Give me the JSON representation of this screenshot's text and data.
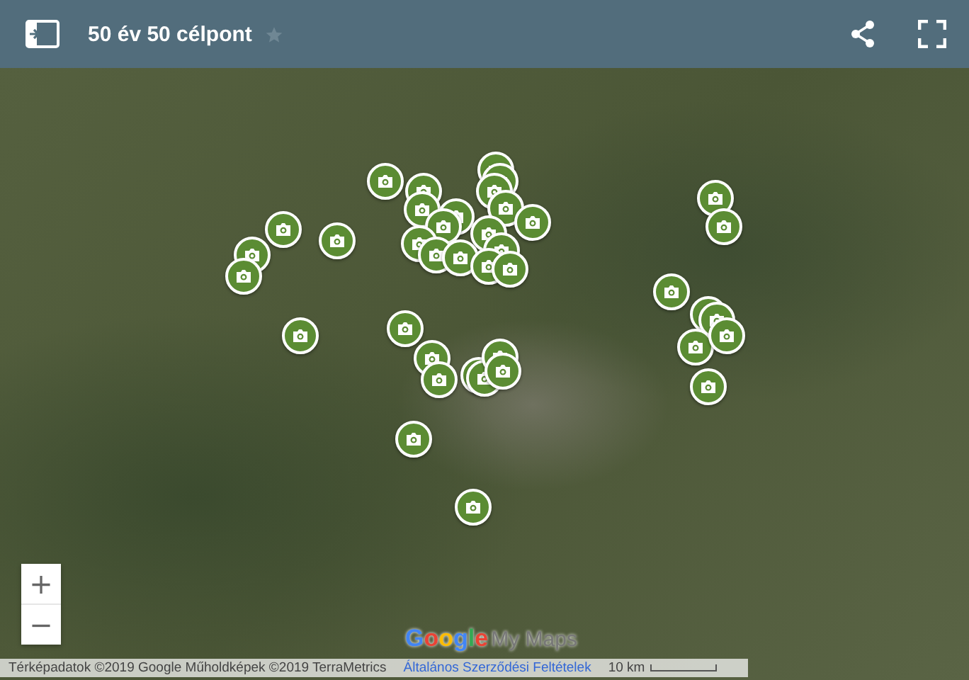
{
  "header": {
    "title": "50 év 50 célpont",
    "starred": false
  },
  "map": {
    "markers": [
      {
        "kind": "photo"
      },
      {
        "kind": "photo"
      },
      {
        "kind": "photo"
      },
      {
        "kind": "photo"
      },
      {
        "kind": "photo"
      },
      {
        "kind": "photo"
      },
      {
        "kind": "photo"
      },
      {
        "kind": "photo"
      },
      {
        "kind": "photo"
      },
      {
        "kind": "photo"
      },
      {
        "kind": "photo"
      },
      {
        "kind": "photo"
      },
      {
        "kind": "photo"
      },
      {
        "kind": "photo"
      },
      {
        "kind": "photo"
      },
      {
        "kind": "photo"
      },
      {
        "kind": "photo"
      },
      {
        "kind": "photo"
      },
      {
        "kind": "photo"
      },
      {
        "kind": "photo"
      },
      {
        "kind": "photo"
      },
      {
        "kind": "photo"
      },
      {
        "kind": "photo"
      },
      {
        "kind": "photo"
      },
      {
        "kind": "photo"
      },
      {
        "kind": "photo"
      },
      {
        "kind": "photo"
      },
      {
        "kind": "photo"
      },
      {
        "kind": "photo"
      },
      {
        "kind": "photo"
      },
      {
        "kind": "photo"
      },
      {
        "kind": "photo"
      },
      {
        "kind": "photo"
      },
      {
        "kind": "photo"
      },
      {
        "kind": "photo"
      },
      {
        "kind": "photo"
      },
      {
        "kind": "photo"
      },
      {
        "kind": "photo"
      },
      {
        "kind": "photo"
      }
    ],
    "zoom_controls": [
      "+",
      "−"
    ],
    "logo": {
      "brand": "Google",
      "product": "My Maps"
    },
    "footer": {
      "attribution": "Térképadatok ©2019 Google Műholdképek ©2019 TerraMetrics",
      "terms_link": "Általános Szerződési Feltételek",
      "scale": "10 km"
    }
  }
}
